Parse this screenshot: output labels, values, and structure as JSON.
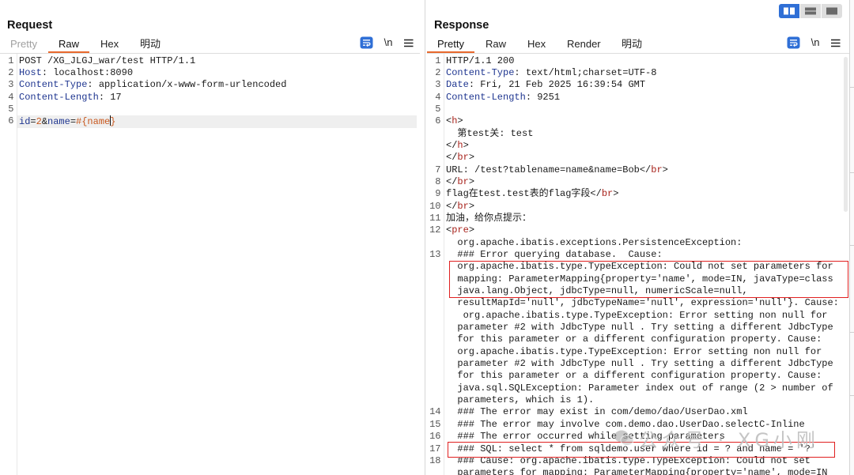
{
  "ui": {
    "layout_toggle": {
      "icons": [
        "columns-icon",
        "rows-icon",
        "single-pane-icon"
      ],
      "selected": "columns-icon"
    }
  },
  "colors": {
    "accent": "#2f6fd6",
    "tab_underline": "#e8692e",
    "annotation_box": "#e02020",
    "header_key": "#1f3690",
    "tag_name": "#a8231c",
    "param_value": "#c8581e"
  },
  "request": {
    "title": "Request",
    "tabs": [
      "Pretty",
      "Raw",
      "Hex",
      "明动"
    ],
    "selected_tab": "Raw",
    "disabled_tabs": [
      "Pretty"
    ],
    "toolbar": {
      "format_icon": "pretty-print-icon",
      "newline_toggle": "\\n",
      "menu_icon": "hamburger-menu-icon"
    },
    "lines": [
      {
        "num": "1",
        "segments": [
          {
            "text": "POST /XG_JLGJ_war/test HTTP/1.1"
          }
        ]
      },
      {
        "num": "2",
        "segments": [
          {
            "text": "Host",
            "style": "key"
          },
          {
            "text": ": localhost:8090"
          }
        ]
      },
      {
        "num": "3",
        "segments": [
          {
            "text": "Content-Type",
            "style": "key"
          },
          {
            "text": ": application/x-www-form-urlencoded"
          }
        ]
      },
      {
        "num": "4",
        "segments": [
          {
            "text": "Content-Length",
            "style": "key"
          },
          {
            "text": ": 17"
          }
        ]
      },
      {
        "num": "5",
        "segments": []
      },
      {
        "num": "6",
        "current": true,
        "segments": [
          {
            "text": "id",
            "style": "param"
          },
          {
            "text": "="
          },
          {
            "text": "2",
            "style": "value"
          },
          {
            "text": "&"
          },
          {
            "text": "name",
            "style": "param"
          },
          {
            "text": "="
          },
          {
            "text": "#{name",
            "style": "value"
          },
          {
            "style": "cursor"
          },
          {
            "text": "}",
            "style": "value"
          }
        ]
      }
    ]
  },
  "response": {
    "title": "Response",
    "tabs": [
      "Pretty",
      "Raw",
      "Hex",
      "Render",
      "明动"
    ],
    "selected_tab": "Pretty",
    "disabled_tabs": [],
    "toolbar": {
      "format_icon": "pretty-print-icon",
      "newline_toggle": "\\n",
      "menu_icon": "hamburger-menu-icon"
    },
    "lines": [
      {
        "num": "1",
        "segments": [
          {
            "text": "HTTP/1.1 200"
          }
        ]
      },
      {
        "num": "2",
        "segments": [
          {
            "text": "Content-Type",
            "style": "key"
          },
          {
            "text": ": text/html;charset=UTF-8"
          }
        ]
      },
      {
        "num": "3",
        "segments": [
          {
            "text": "Date",
            "style": "key"
          },
          {
            "text": ": Fri, 21 Feb 2025 16:39:54 GMT"
          }
        ]
      },
      {
        "num": "4",
        "segments": [
          {
            "text": "Content-Length",
            "style": "key"
          },
          {
            "text": ": 9251"
          }
        ]
      },
      {
        "num": "5",
        "segments": []
      },
      {
        "num": "6",
        "segments": [
          {
            "text": "<"
          },
          {
            "text": "h",
            "style": "tag"
          },
          {
            "text": ">"
          }
        ]
      },
      {
        "num": "",
        "segments": [
          {
            "text": "  第test关: test"
          }
        ]
      },
      {
        "num": "",
        "segments": [
          {
            "text": "</"
          },
          {
            "text": "h",
            "style": "tag"
          },
          {
            "text": ">"
          }
        ]
      },
      {
        "num": "",
        "segments": [
          {
            "text": "</"
          },
          {
            "text": "br",
            "style": "tag"
          },
          {
            "text": ">"
          }
        ]
      },
      {
        "num": "7",
        "segments": [
          {
            "text": "URL: /test?tablename=name&name=Bob</"
          },
          {
            "text": "br",
            "style": "tag"
          },
          {
            "text": ">"
          }
        ]
      },
      {
        "num": "8",
        "segments": [
          {
            "text": "</"
          },
          {
            "text": "br",
            "style": "tag"
          },
          {
            "text": ">"
          }
        ]
      },
      {
        "num": "9",
        "segments": [
          {
            "text": "flag在test.test表的flag字段</"
          },
          {
            "text": "br",
            "style": "tag"
          },
          {
            "text": ">"
          }
        ]
      },
      {
        "num": "10",
        "segments": [
          {
            "text": "</"
          },
          {
            "text": "br",
            "style": "tag"
          },
          {
            "text": ">"
          }
        ]
      },
      {
        "num": "11",
        "segments": [
          {
            "text": "加油，给你点提示："
          }
        ]
      },
      {
        "num": "12",
        "segments": [
          {
            "text": "<"
          },
          {
            "text": "pre",
            "style": "tag"
          },
          {
            "text": ">"
          }
        ]
      },
      {
        "num": "",
        "segments": [
          {
            "text": "  org.apache.ibatis.exceptions.PersistenceException:"
          }
        ]
      },
      {
        "num": "13",
        "segments": [
          {
            "text": "  ### Error querying database.  Cause:"
          }
        ]
      },
      {
        "num": "",
        "segments": [
          {
            "text": "  org.apache.ibatis.type.TypeException: Could not set parameters for"
          }
        ]
      },
      {
        "num": "",
        "segments": [
          {
            "text": "  mapping: ParameterMapping{property='name', mode=IN, javaType=class"
          }
        ]
      },
      {
        "num": "",
        "segments": [
          {
            "text": "  java.lang.Object, jdbcType=null, numericScale=null,"
          }
        ]
      },
      {
        "num": "",
        "segments": [
          {
            "text": "  resultMapId='null', jdbcTypeName='null', expression='null'}. Cause:"
          }
        ]
      },
      {
        "num": "",
        "segments": [
          {
            "text": "   org.apache.ibatis.type.TypeException: Error setting non null for"
          }
        ]
      },
      {
        "num": "",
        "segments": [
          {
            "text": "  parameter #2 with JdbcType null . Try setting a different JdbcType"
          }
        ]
      },
      {
        "num": "",
        "segments": [
          {
            "text": "  for this parameter or a different configuration property. Cause:"
          }
        ]
      },
      {
        "num": "",
        "segments": [
          {
            "text": "  org.apache.ibatis.type.TypeException: Error setting non null for"
          }
        ]
      },
      {
        "num": "",
        "segments": [
          {
            "text": "  parameter #2 with JdbcType null . Try setting a different JdbcType"
          }
        ]
      },
      {
        "num": "",
        "segments": [
          {
            "text": "  for this parameter or a different configuration property. Cause:"
          }
        ]
      },
      {
        "num": "",
        "segments": [
          {
            "text": "  java.sql.SQLException: Parameter index out of range (2 > number of"
          }
        ]
      },
      {
        "num": "",
        "segments": [
          {
            "text": "  parameters, which is 1)."
          }
        ]
      },
      {
        "num": "14",
        "segments": [
          {
            "text": "  ### The error may exist in com/demo/dao/UserDao.xml"
          }
        ]
      },
      {
        "num": "15",
        "segments": [
          {
            "text": "  ### The error may involve com.demo.dao.UserDao.selectC-Inline"
          }
        ]
      },
      {
        "num": "16",
        "segments": [
          {
            "text": "  ### The error occurred while setting parameters"
          }
        ]
      },
      {
        "num": "17",
        "segments": [
          {
            "text": "  ### SQL: select * from sqldemo.user where id = ? and name = '?'"
          }
        ]
      },
      {
        "num": "18",
        "segments": [
          {
            "text": "  ### Cause: org.apache.ibatis.type.TypeException: Could not set"
          }
        ]
      },
      {
        "num": "",
        "segments": [
          {
            "text": "  parameters for mapping: ParameterMapping{property='name', mode=IN"
          }
        ]
      }
    ]
  },
  "watermark": {
    "icon": "wechat-logo-icon",
    "text": "公众号 · XG小刚"
  }
}
